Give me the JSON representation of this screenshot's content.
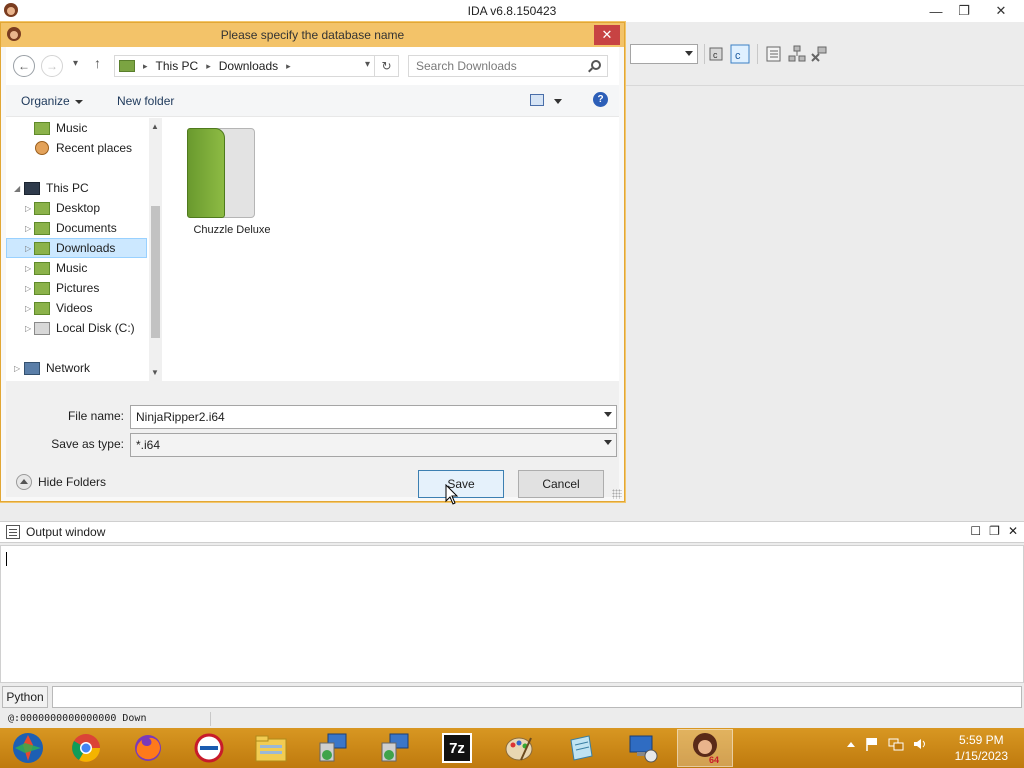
{
  "ida": {
    "title": "IDA v6.8.150423",
    "window_controls": {
      "minimize": "—",
      "restore": "❐",
      "close": "✕"
    }
  },
  "dialog": {
    "title": "Please specify the database name",
    "close": "✕",
    "nav": {
      "back": "←",
      "forward": "→",
      "recent": "▾",
      "up": "↑"
    },
    "breadcrumb": [
      "This PC",
      "Downloads"
    ],
    "breadcrumb_sep": "▸",
    "address_dropdown": "▾",
    "refresh": "↻",
    "search_placeholder": "Search Downloads",
    "toolbar": {
      "organize": "Organize",
      "new_folder": "New folder",
      "help": "?"
    },
    "tree": {
      "items": [
        {
          "label": "Music",
          "expander": ""
        },
        {
          "label": "Recent places",
          "expander": ""
        },
        {
          "label": "This PC",
          "expander": "◢"
        },
        {
          "label": "Desktop",
          "expander": "▷"
        },
        {
          "label": "Documents",
          "expander": "▷"
        },
        {
          "label": "Downloads",
          "expander": "▷"
        },
        {
          "label": "Music",
          "expander": "▷"
        },
        {
          "label": "Pictures",
          "expander": "▷"
        },
        {
          "label": "Videos",
          "expander": "▷"
        },
        {
          "label": "Local Disk (C:)",
          "expander": "▷"
        },
        {
          "label": "Network",
          "expander": "▷"
        }
      ],
      "scroll_up": "▲",
      "scroll_down": "▼"
    },
    "files": [
      {
        "name": "Chuzzle Deluxe"
      }
    ],
    "file_name_label": "File name:",
    "file_name_value": "NinjaRipper2.i64",
    "save_type_label": "Save as type:",
    "save_type_value": "*.i64",
    "hide_folders": "Hide Folders",
    "save_button": "Save",
    "cancel_button": "Cancel"
  },
  "output": {
    "title": "Output window",
    "controls": {
      "maximize": "☐",
      "float": "❐",
      "close": "✕"
    }
  },
  "python_button": "Python",
  "status_text": "@:0000000000000000 Down",
  "taskbar": {
    "apps": [
      "start",
      "chrome",
      "firefox",
      "opera",
      "file-explorer",
      "network-setup",
      "network-setup-2",
      "7zip",
      "paint",
      "notepad",
      "remote-desktop",
      "ida"
    ],
    "label_7z": "7z",
    "time": "5:59 PM",
    "date": "1/15/2023"
  },
  "colors": {
    "dialog_accent": "#f3c369",
    "taskbar": "#c98412",
    "selection": "#cce8ff",
    "close_red": "#c74343"
  }
}
